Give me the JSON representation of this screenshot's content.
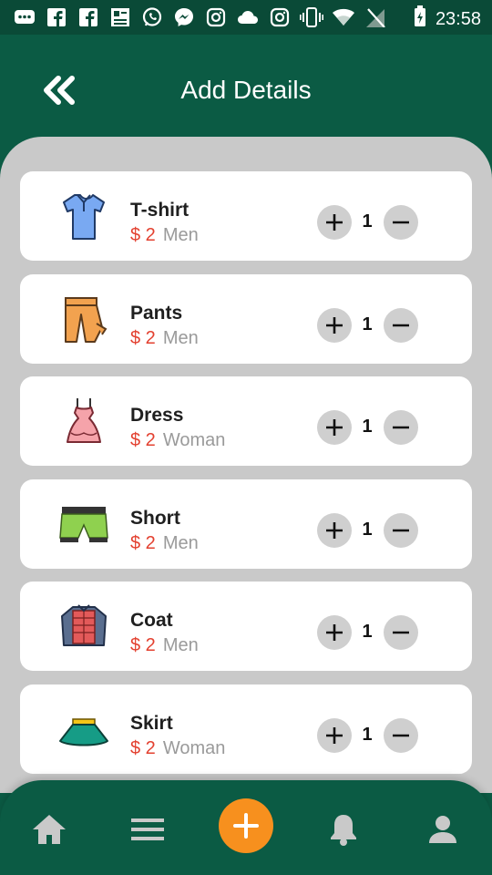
{
  "status": {
    "time": "23:58",
    "icons": [
      "message-icon",
      "facebook-icon",
      "facebook-icon",
      "news-icon",
      "whatsapp-icon",
      "messenger-icon",
      "instagram-icon",
      "cloud-icon",
      "instagram-icon",
      "vibrate-icon",
      "wifi-icon",
      "no-sim-icon",
      "battery-icon"
    ]
  },
  "header": {
    "title": "Add Details",
    "back_icon": "double-chevron-left-icon"
  },
  "items": [
    {
      "name": "T-shirt",
      "price": "$ 2",
      "gender": "Men",
      "qty": "1",
      "icon": "tshirt-icon"
    },
    {
      "name": "Pants",
      "price": "$ 2",
      "gender": "Men",
      "qty": "1",
      "icon": "pants-icon"
    },
    {
      "name": "Dress",
      "price": "$ 2",
      "gender": "Woman",
      "qty": "1",
      "icon": "dress-icon"
    },
    {
      "name": "Short",
      "price": "$ 2",
      "gender": "Men",
      "qty": "1",
      "icon": "shorts-icon"
    },
    {
      "name": "Coat",
      "price": "$ 2",
      "gender": "Men",
      "qty": "1",
      "icon": "coat-icon"
    },
    {
      "name": "Skirt",
      "price": "$ 2",
      "gender": "Woman",
      "qty": "1",
      "icon": "skirt-icon"
    }
  ],
  "nav": {
    "items": [
      "home-icon",
      "menu-icon",
      "add-icon",
      "bell-icon",
      "profile-icon"
    ]
  },
  "colors": {
    "header_bg": "#0b5b44",
    "panel_bg": "#c9c9c9",
    "price": "#e3402f",
    "fab": "#f7901e"
  }
}
